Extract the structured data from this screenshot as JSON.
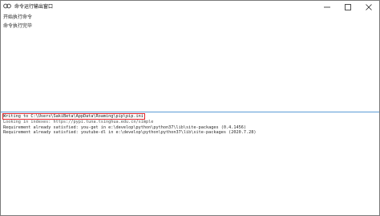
{
  "window": {
    "title": "命令运行输出窗口"
  },
  "icons": {
    "app": "app-logo-icon",
    "minimize": "minimize-icon",
    "maximize": "maximize-icon",
    "close": "close-icon"
  },
  "top_panel": {
    "status_start": "开始执行命令",
    "status_done": "命令执行完毕"
  },
  "output": {
    "lines": [
      "Writing to C:\\Users\\SakiBeta\\AppData\\Roaming\\pip\\pip.ini",
      "Looking in indexes: https://pypi.tuna.tsinghua.edu.cn/simple",
      "Requirement already satisfied: you-get in e:\\develop\\python\\python37\\lib\\site-packages (0.4.1456)",
      "Requirement already satisfied: youtube-dl in e:\\develop\\python\\python37\\lib\\site-packages (2020.7.28)"
    ]
  },
  "colors": {
    "highlight_border": "#e0242b",
    "splitter": "#5b9bd5"
  }
}
